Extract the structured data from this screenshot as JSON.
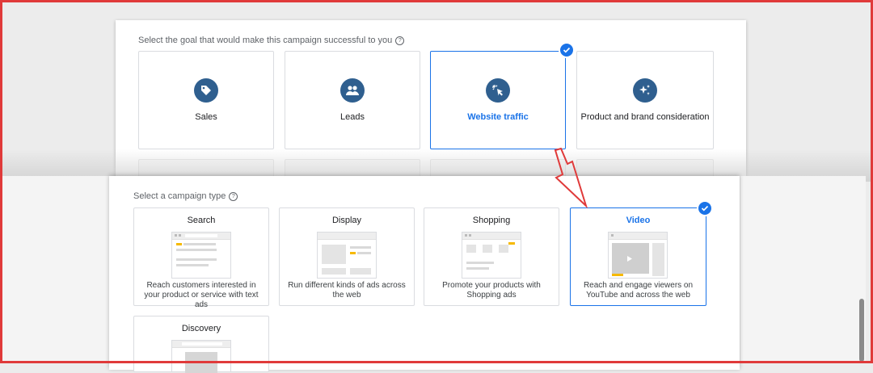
{
  "goals": {
    "prompt": "Select the goal that would make this campaign successful to you",
    "help": "?",
    "items": [
      {
        "label": "Sales",
        "icon": "tag-icon"
      },
      {
        "label": "Leads",
        "icon": "people-icon"
      },
      {
        "label": "Website traffic",
        "icon": "cursor-click-icon",
        "selected": true
      },
      {
        "label": "Product and brand consideration",
        "icon": "sparkle-icon"
      }
    ]
  },
  "campaign_types": {
    "prompt": "Select a campaign type",
    "help": "?",
    "items": [
      {
        "title": "Search",
        "description": "Reach customers interested in your product or service with text ads"
      },
      {
        "title": "Display",
        "description": "Run different kinds of ads across the web"
      },
      {
        "title": "Shopping",
        "description": "Promote your products with Shopping ads"
      },
      {
        "title": "Video",
        "description": "Reach and engage viewers on YouTube and across the web",
        "selected": true
      },
      {
        "title": "Discovery",
        "description": ""
      }
    ]
  },
  "colors": {
    "accent": "#1a73e8",
    "icon_bg": "#2f5f8f",
    "annotation": "#e03a3a",
    "ad_highlight": "#f6b900"
  }
}
